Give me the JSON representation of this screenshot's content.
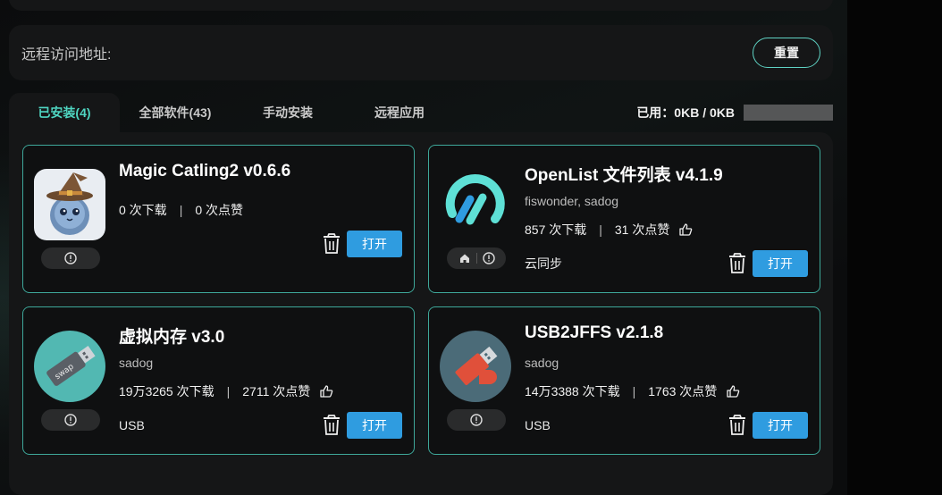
{
  "remote": {
    "label": "远程访问地址:",
    "reset_label": "重置"
  },
  "tabs": [
    {
      "label": "已安装(4)",
      "active": true
    },
    {
      "label": "全部软件(43)",
      "active": false
    },
    {
      "label": "手动安装",
      "active": false
    },
    {
      "label": "远程应用",
      "active": false
    }
  ],
  "usage": {
    "text": "已用：0KB / 0KB"
  },
  "apps": [
    {
      "name": "Magic Catling2 v0.6.6",
      "author": "",
      "downloads": "0 次下载",
      "likes": "0 次点赞",
      "tag": "",
      "open_label": "打开",
      "icon": "wizard-cat-icon"
    },
    {
      "name": "OpenList 文件列表 v4.1.9",
      "author": "fiswonder, sadog",
      "downloads": "857 次下载",
      "likes": "31 次点赞",
      "tag": "云同步",
      "open_label": "打开",
      "icon": "openlist-logo-icon"
    },
    {
      "name": "虚拟内存 v3.0",
      "author": "sadog",
      "downloads": "19万3265 次下载",
      "likes": "2711 次点赞",
      "tag": "USB",
      "open_label": "打开",
      "icon": "swap-usb-icon"
    },
    {
      "name": "USB2JFFS v2.1.8",
      "author": "sadog",
      "downloads": "14万3388 次下载",
      "likes": "1763 次点赞",
      "tag": "USB",
      "open_label": "打开",
      "icon": "usb-drive-icon"
    }
  ],
  "colors": {
    "accent": "#4fd6c2",
    "button": "#2f9ce0",
    "card_border": "#3ea89a"
  }
}
